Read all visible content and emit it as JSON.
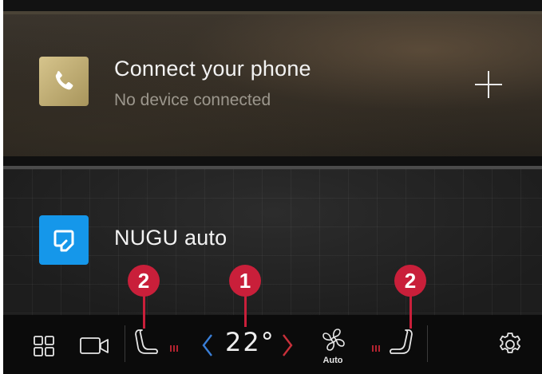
{
  "phone_card": {
    "title": "Connect your phone",
    "subtitle": "No device connected",
    "icon": "phone-icon",
    "action_icon": "plus-icon"
  },
  "nugu_card": {
    "title": "NUGU auto",
    "icon": "nugu-chat-icon"
  },
  "callouts": {
    "left_seat": "2",
    "temperature": "1",
    "right_seat": "2"
  },
  "climate_bar": {
    "temperature": "22°",
    "fan_label": "Auto",
    "icons": [
      "app-grid-icon",
      "camera-icon",
      "seat-heater-icon",
      "chevron-left-icon",
      "chevron-right-icon",
      "fan-icon",
      "seat-heater-icon",
      "settings-gear-icon"
    ]
  },
  "colors": {
    "callout_red": "#c91f3a",
    "nugu_blue": "#1597ea",
    "phone_gold": "#c4b278",
    "temp_down_blue": "#3a7fd8",
    "temp_up_red": "#c9303a"
  }
}
